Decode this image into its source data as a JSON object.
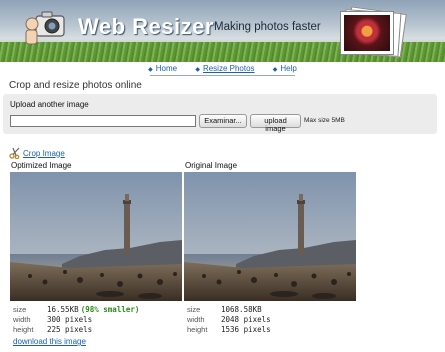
{
  "header": {
    "brand": "Web Resizer",
    "tagline": "Making photos faster"
  },
  "nav": {
    "items": [
      {
        "label": "Home",
        "active": false
      },
      {
        "label": "Resize Photos",
        "active": true
      },
      {
        "label": "Help",
        "active": false
      }
    ]
  },
  "page": {
    "title": "Crop and resize photos online"
  },
  "upload": {
    "title": "Upload another image",
    "file_value": "",
    "browse_label": "Examinar...",
    "upload_label": "upload image",
    "max_size": "Max size 5MB"
  },
  "crop": {
    "label": "Crop Image",
    "icon": "scissors-icon"
  },
  "optimized": {
    "label": "Optimized Image",
    "size_key": "size",
    "size": "16.55KB",
    "saving": "(98% smaller)",
    "width_key": "width",
    "width": "300 pixels",
    "height_key": "height",
    "height": "225 pixels",
    "download": "download this image"
  },
  "original": {
    "label": "Original Image",
    "size_key": "size",
    "size": "1068.58KB",
    "width_key": "width",
    "width": "2048 pixels",
    "height_key": "height",
    "height": "1536 pixels"
  },
  "colors": {
    "link": "#1b5fb0",
    "saving": "#2a8a1a",
    "upload_bg": "#ececec"
  }
}
